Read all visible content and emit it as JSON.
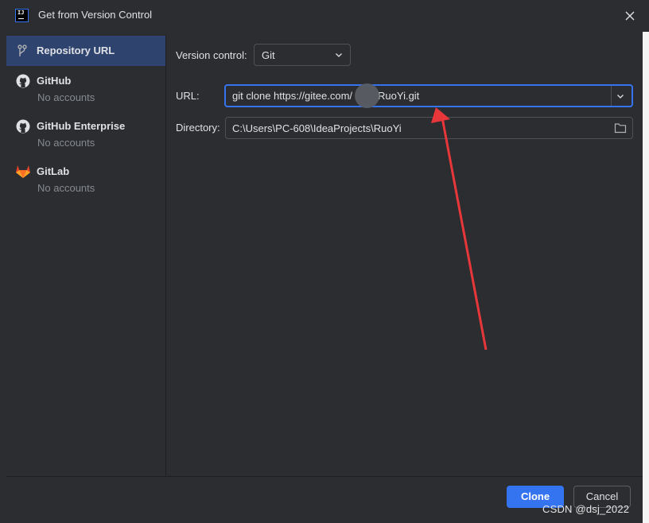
{
  "window": {
    "title": "Get from Version Control",
    "close_glyph": "✕"
  },
  "sidebar": {
    "items": [
      {
        "label": "Repository URL",
        "icon": "vcs-branch-icon",
        "sub": ""
      },
      {
        "label": "GitHub",
        "icon": "github-icon",
        "sub": "No accounts"
      },
      {
        "label": "GitHub Enterprise",
        "icon": "github-icon",
        "sub": "No accounts"
      },
      {
        "label": "GitLab",
        "icon": "gitlab-icon",
        "sub": "No accounts"
      }
    ]
  },
  "form": {
    "vcs_label": "Version control:",
    "vcs_value": "Git",
    "url_label": "URL:",
    "url_value": "git clone https://gitee.com/RuoYi.git",
    "url_value_left": "git clone https://gitee.com/",
    "url_value_right": "RuoYi.git",
    "dir_label": "Directory:",
    "dir_value": "C:\\Users\\PC-608\\IdeaProjects\\RuoYi"
  },
  "footer": {
    "clone_label": "Clone",
    "cancel_label": "Cancel"
  },
  "watermark": "CSDN @dsj_2022",
  "colors": {
    "accent": "#3574f0",
    "selection": "#2e436e",
    "annotation_arrow": "#e8373a"
  }
}
